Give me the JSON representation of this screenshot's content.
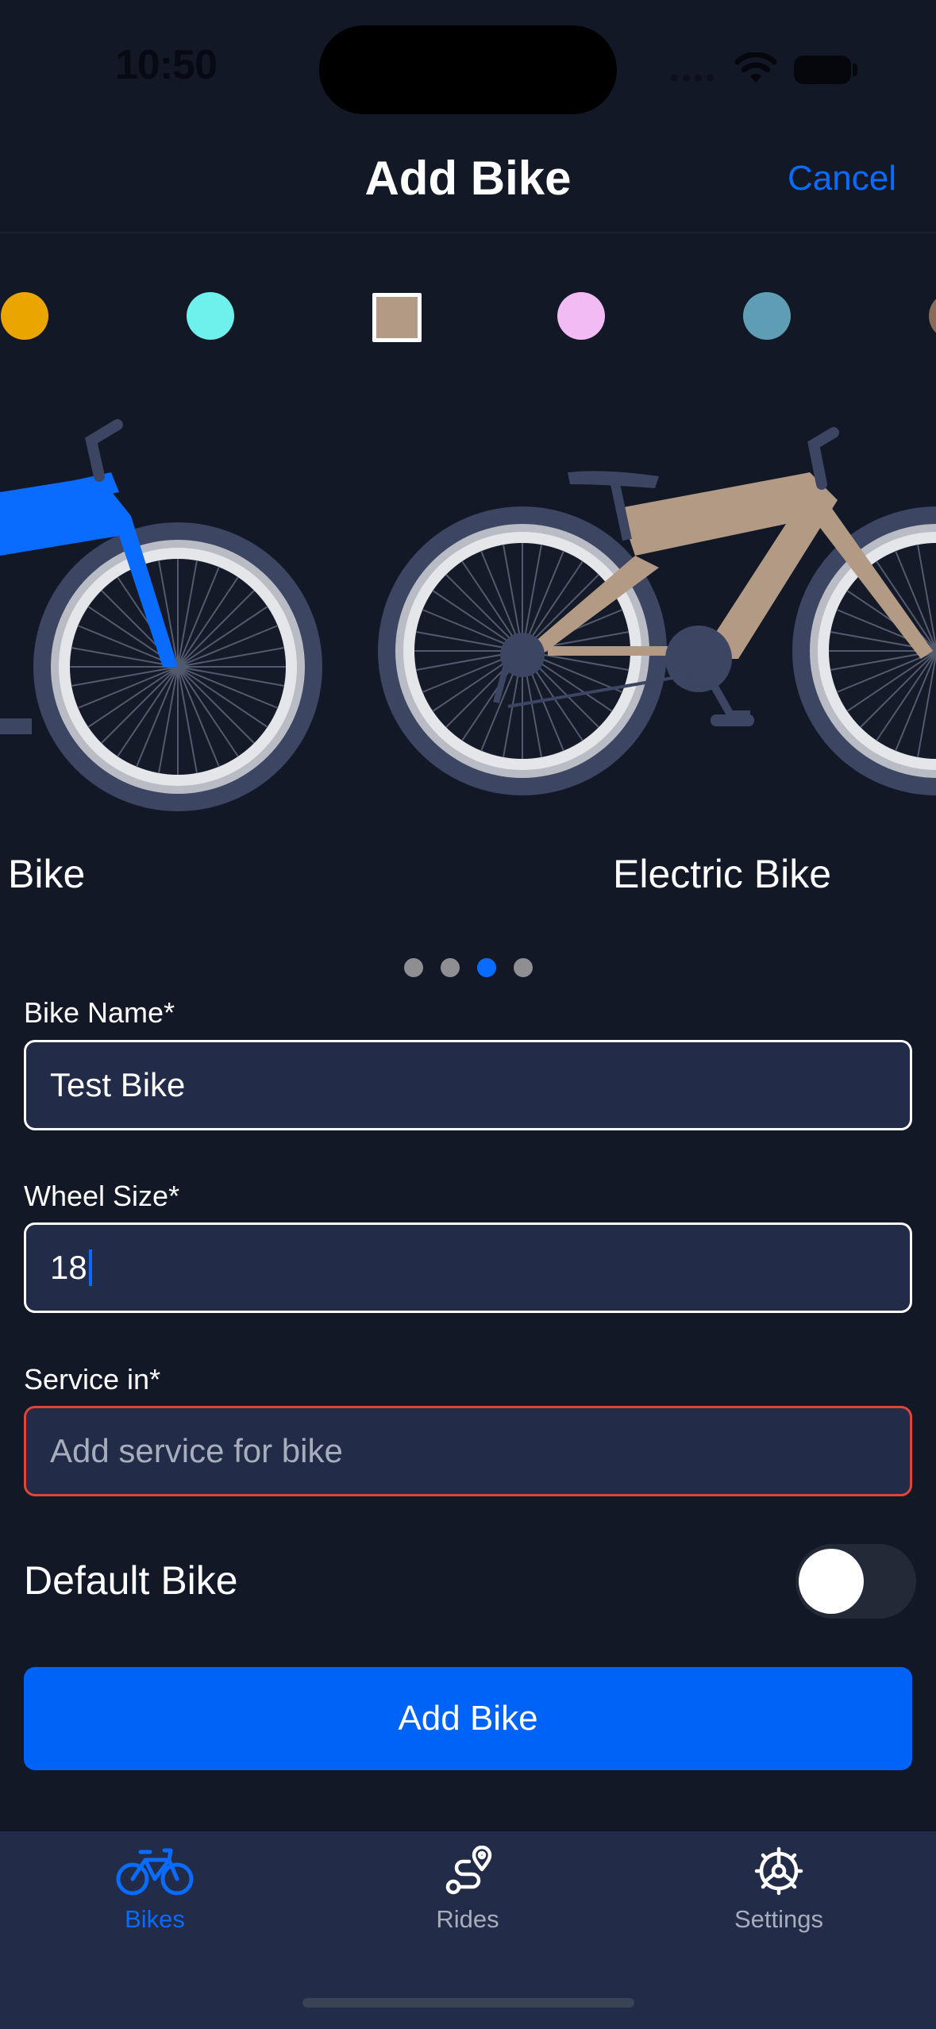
{
  "status_bar": {
    "time": "10:50"
  },
  "nav": {
    "title": "Add Bike",
    "cancel_label": "Cancel"
  },
  "color_swatches": [
    {
      "name": "yellow",
      "color": "#eba500"
    },
    {
      "name": "cyan",
      "color": "#6ef0ec"
    },
    {
      "name": "tan",
      "color": "#b39a84",
      "selected": true
    },
    {
      "name": "pink",
      "color": "#f3bbf4"
    },
    {
      "name": "steel-blue",
      "color": "#5f9db5"
    },
    {
      "name": "brown",
      "color": "#8a6b57"
    }
  ],
  "bike_types": [
    {
      "label": "Bike",
      "color": "#0a6cff"
    },
    {
      "label": "Electric Bike",
      "color": "#b39a84"
    }
  ],
  "carousel": {
    "pages": 4,
    "active_index": 2
  },
  "form": {
    "bike_name": {
      "label": "Bike Name*",
      "value": "Test Bike"
    },
    "wheel_size": {
      "label": "Wheel Size*",
      "value": "18"
    },
    "service_in": {
      "label": "Service in*",
      "placeholder": "Add service for bike",
      "value": ""
    },
    "default_bike": {
      "label": "Default Bike",
      "on": false
    },
    "submit_label": "Add Bike"
  },
  "tab_bar": {
    "tabs": [
      {
        "label": "Bikes",
        "icon": "bike-icon",
        "active": true
      },
      {
        "label": "Rides",
        "icon": "route-icon",
        "active": false
      },
      {
        "label": "Settings",
        "icon": "gear-icon",
        "active": false
      }
    ]
  },
  "colors": {
    "accent": "#0a6cff",
    "background": "#121826",
    "field_bg": "#222b47",
    "error": "#e0453a"
  }
}
